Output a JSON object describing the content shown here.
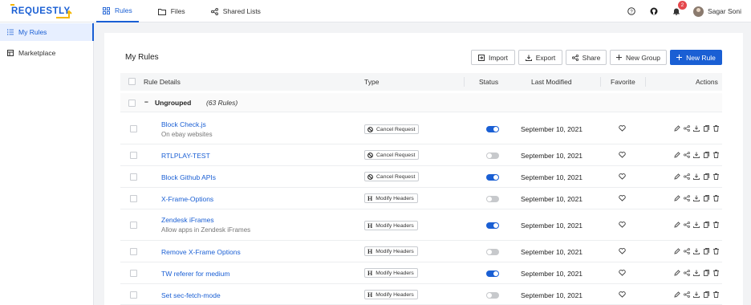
{
  "app": {
    "logo_text": "REQUESTLY"
  },
  "nav": [
    {
      "label": "Rules",
      "icon": "rules-icon",
      "active": true
    },
    {
      "label": "Files",
      "icon": "folder-icon",
      "active": false
    },
    {
      "label": "Shared Lists",
      "icon": "share-icon",
      "active": false
    }
  ],
  "header": {
    "notification_count": "2",
    "user_name": "Sagar Soni"
  },
  "sidebar": {
    "items": [
      {
        "label": "My Rules",
        "icon": "list-icon",
        "active": true
      },
      {
        "label": "Marketplace",
        "icon": "store-icon",
        "active": false
      }
    ]
  },
  "main": {
    "title": "My Rules",
    "buttons": {
      "import": "Import",
      "export": "Export",
      "share": "Share",
      "new_group": "New Group",
      "new_rule": "New Rule"
    },
    "columns": [
      "Rule Details",
      "Type",
      "Status",
      "Last Modified",
      "Favorite",
      "Actions"
    ],
    "group": {
      "name": "Ungrouped",
      "count": "(63 Rules)"
    },
    "rows": [
      {
        "name": "Block Check.js",
        "description": "On ebay websites",
        "type": "Cancel Request",
        "type_icon": "cancel-icon",
        "status_on": true,
        "modified": "September 10, 2021"
      },
      {
        "name": "RTLPLAY-TEST",
        "description": "",
        "type": "Cancel Request",
        "type_icon": "cancel-icon",
        "status_on": false,
        "modified": "September 10, 2021"
      },
      {
        "name": "Block Github APIs",
        "description": "",
        "type": "Cancel Request",
        "type_icon": "cancel-icon",
        "status_on": true,
        "modified": "September 10, 2021"
      },
      {
        "name": "X-Frame-Options",
        "description": "",
        "type": "Modify Headers",
        "type_icon": "header-icon",
        "status_on": false,
        "modified": "September 10, 2021"
      },
      {
        "name": "Zendesk iFrames",
        "description": "Allow apps in Zendesk iFrames",
        "type": "Modify Headers",
        "type_icon": "header-icon",
        "status_on": true,
        "modified": "September 10, 2021"
      },
      {
        "name": "Remove X-Frame Options",
        "description": "",
        "type": "Modify Headers",
        "type_icon": "header-icon",
        "status_on": false,
        "modified": "September 10, 2021"
      },
      {
        "name": "TW referer for medium",
        "description": "",
        "type": "Modify Headers",
        "type_icon": "header-icon",
        "status_on": true,
        "modified": "September 10, 2021"
      },
      {
        "name": "Set sec-fetch-mode",
        "description": "",
        "type": "Modify Headers",
        "type_icon": "header-icon",
        "status_on": false,
        "modified": "September 10, 2021"
      }
    ]
  },
  "colors": {
    "accent": "#1a5fd4",
    "toggle_off": "#c7c9cc",
    "badge": "#e5484d"
  }
}
